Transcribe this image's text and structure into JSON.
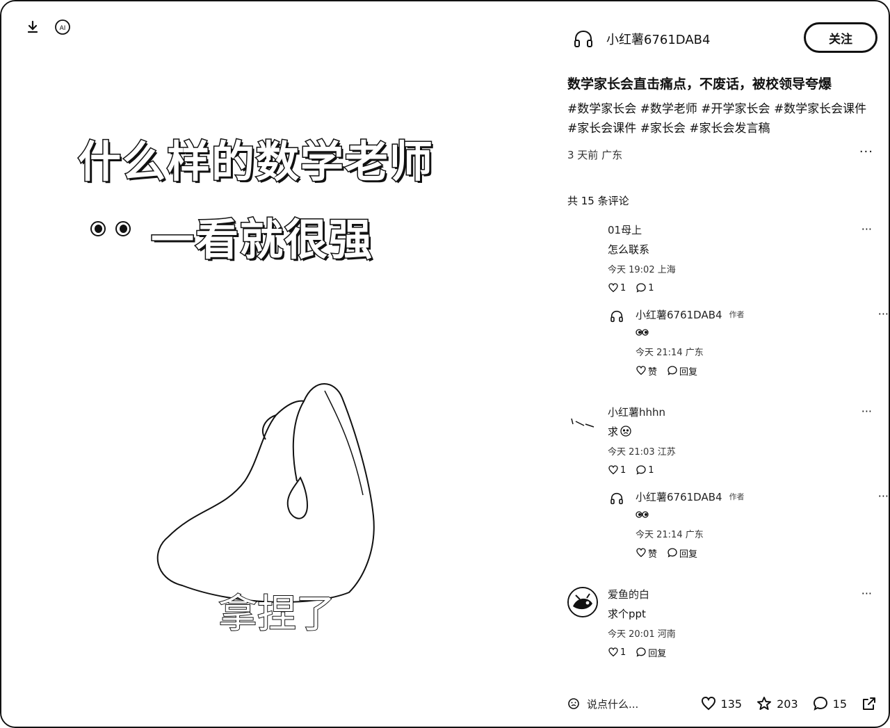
{
  "media": {
    "headline_line1": "什么样的数学老师",
    "headline_line2": "一看就很强",
    "caption": "拿捏了"
  },
  "author": {
    "name": "小红薯6761DAB4",
    "follow_label": "关注"
  },
  "post": {
    "title": "数学家长会直击痛点，不废话，被校领导夸爆",
    "tags": "#数学家长会 #数学老师 #开学家长会 #数学家长会课件 #家长会课件 #家长会 #家长会发言稿",
    "meta": "3 天前 广东",
    "more": "···"
  },
  "comments_header": "共 15 条评论",
  "comments": [
    {
      "name": "01母上",
      "text": "怎么联系",
      "meta": "今天 19:02 上海",
      "likes": "1",
      "replies": "1",
      "more": "···",
      "reply": {
        "name": "小红薯6761DAB4",
        "badge": "作者",
        "meta": "今天 21:14 广东",
        "like_label": "赞",
        "reply_label": "回复",
        "more": "···"
      }
    },
    {
      "name": "小红薯hhhn",
      "text": "求",
      "meta": "今天 21:03 江苏",
      "likes": "1",
      "replies": "1",
      "more": "···",
      "reply": {
        "name": "小红薯6761DAB4",
        "badge": "作者",
        "meta": "今天 21:14 广东",
        "like_label": "赞",
        "reply_label": "回复",
        "more": "···"
      }
    },
    {
      "name": "爱鱼的白",
      "text": "求个ppt",
      "meta": "今天 20:01 河南",
      "likes": "1",
      "reply_label": "回复",
      "more": "···"
    }
  ],
  "bottom": {
    "say_placeholder": "说点什么...",
    "likes": "135",
    "collects": "203",
    "comments": "15"
  }
}
